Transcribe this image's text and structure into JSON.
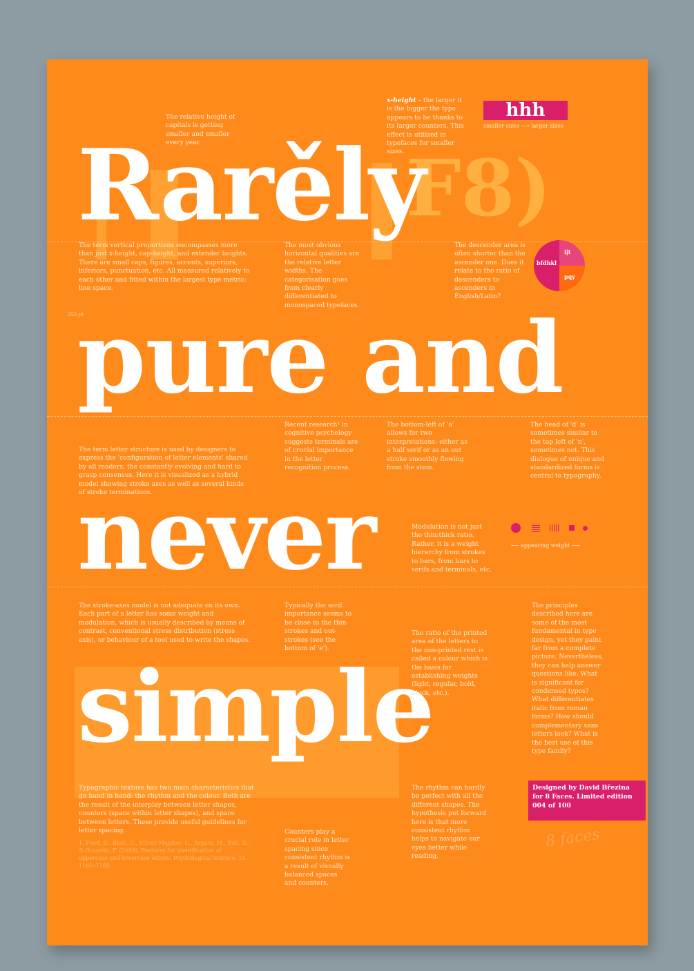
{
  "headline": {
    "word1": "Rarěly",
    "word1_ghost": "F8)",
    "word2": "pure and",
    "word3": "never",
    "word4": "simple"
  },
  "notes": {
    "capitals": "The relative height of capitals is getting smaller and smaller every year.",
    "xheight_lead": "x-height",
    "xheight": " – the larger it is the bigger the type appears to be thanks to its larger counters. This effect is utilized in typefaces for smaller sizes.",
    "hhh_sample": "hhh",
    "hhh_caption": "smaller sizes ⟷ larger sizes",
    "vertical": "The term vertical proportions encompasses more than just x-height, cap-height, and extender heights. There are small caps, figures, accents, superiors, inferiors, punctuation, etc. All measured relatively to each other and fitted within the largest type metric: line space.",
    "widths": "The most obvious horizontal qualities are the relative letter widths. The categorisation goes from clearly differentiated to monospaced typefaces.",
    "descender": "The descender area is often shorter than the ascender one. Does it relate to the ratio of descenders to ascenders in English/Latin?",
    "pie_label_left": "bfdhkl",
    "pie_label_top": "ijt",
    "pie_label_bottom": "pqy",
    "pt_label": "255 pt",
    "research": "Recent research¹ in cognitive psychology suggests terminals are of crucial importance in the letter recognition process.",
    "bottom_left": "The bottom-left of 'a' allows for two interpretations: either as a half serif or as an out stroke smoothly flowing from the stem.",
    "head_d": "The head of 'd' is sometimes similar to the top left of 'n', sometimes not. This dialogue of unique and standardized forms is central to typography.",
    "structure": "The term letter structure is used by designers to express the 'configuration of letter elements' shared by all readers; the constantly evolving and hard to grasp consensus. Here it is visualized as a hybrid model showing stroke axes as well as several kinds of stroke terminations.",
    "modulation": "Modulation is not just the thin:thick ratio. Rather, it is a weight hierarchy from strokes to bars, from bars to serifs and terminals, etc.",
    "appearing_weight": "⟵ appearing weight ⟶",
    "stroke_axes": "The stroke-axes model is not adequate on its own. Each part of a letter has some weight and modulation, which is usually described by means of contrast, conventional stress distribution (stress axis), or behaviour of a tool used to write the shapes.",
    "serif": "Typically the serif importance seems to be close to the thin strokes and out-strokes (see the bottom of 'e').",
    "colour": "The ratio of the printed area of the letters to the non-printed rest is called a colour which is the basis for establishing weights (light, regular, bold, black, etc.).",
    "principles": "The principles described here are some of the most fundamental in type design, yet they paint far from a complete picture. Nevertheless, they can help answer questions like: What is significant for condensed types? What differentiates italic from roman forms? How should complementary sans letters look? What is the best use of this type family?",
    "texture": "Typographic texture has two main characteristics that go hand in hand: the rhythm and the colour. Both are the result of the interplay between letter shapes, counters (space within letter shapes), and space between letters. These provide useful guidelines for letter spacing.",
    "rhythm": "The rhythm can hardly be perfect with all the different shapes. The hypothesis put forward here is that more consistent rhythm helps to navigate our eyes better while reading.",
    "counters": "Counters play a crucial role in letter spacing since consistent rhythm is a result of visually balanced spaces and counters.",
    "footnote": "1. Fiset, D., Blais, C., Éthier-Majcher, C., Arguin, M., Bub, D., & Gosselin, F. (2008). Features for identification of uppercase and lowercase letters. Psychological Science, 19, 1161–1168."
  },
  "credit": {
    "line1": "Designed by David Březina",
    "line2": "for 8 Faces. Limited edition",
    "line3": "004 of 100"
  },
  "signature": "8 faces",
  "colors": {
    "poster": "#ff8a1c",
    "accent": "#d91e6a",
    "background": "#8d9ca2"
  }
}
